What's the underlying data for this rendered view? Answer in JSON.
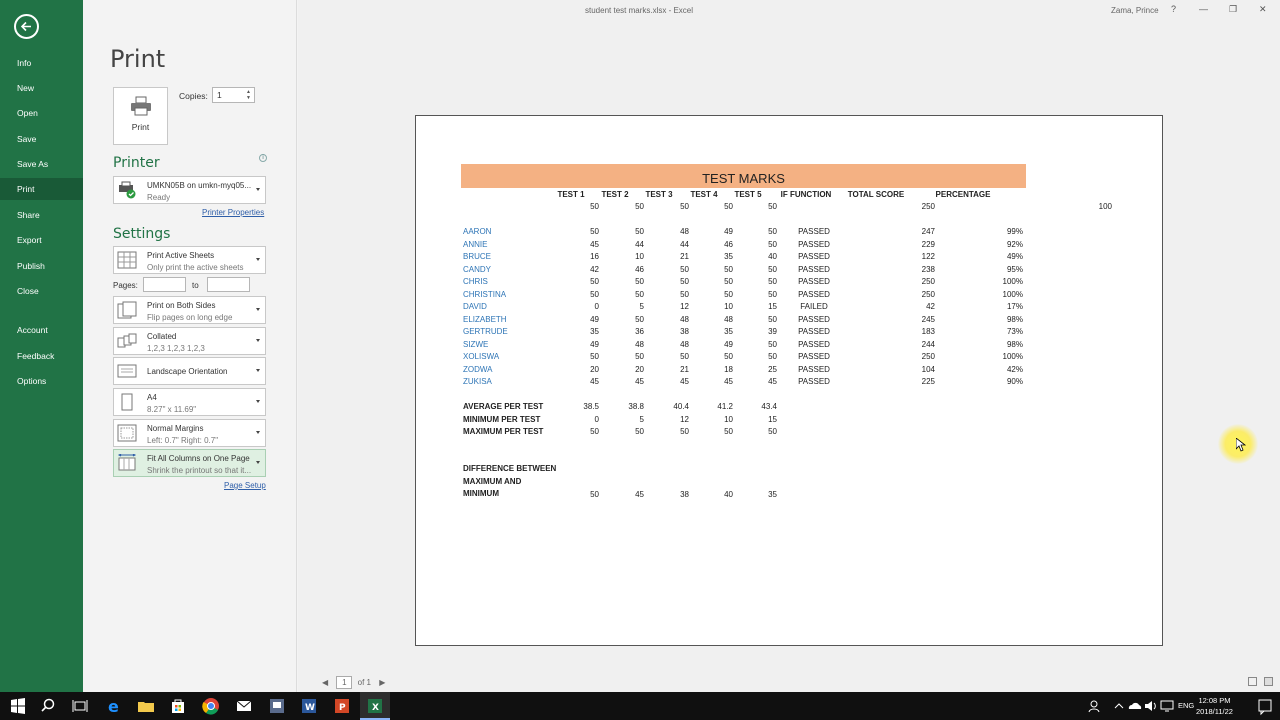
{
  "window": {
    "title": "student test marks.xlsx  -  Excel",
    "user": "Zama, Prince",
    "help": "?"
  },
  "nav": {
    "items": [
      "Info",
      "New",
      "Open",
      "Save",
      "Save As",
      "Print",
      "Share",
      "Export",
      "Publish",
      "Close",
      "Account",
      "Feedback",
      "Options"
    ],
    "active": "Print"
  },
  "print": {
    "heading": "Print",
    "button_label": "Print",
    "copies_label": "Copies:",
    "copies_value": "1"
  },
  "printer": {
    "heading": "Printer",
    "name": "UMKN05B on umkn-myq05...",
    "status": "Ready",
    "properties_link": "Printer Properties"
  },
  "settings": {
    "heading": "Settings",
    "sheets": {
      "title": "Print Active Sheets",
      "sub": "Only print the active sheets"
    },
    "pages_label": "Pages:",
    "to_label": "to",
    "sides": {
      "title": "Print on Both Sides",
      "sub": "Flip pages on long edge"
    },
    "collate": {
      "title": "Collated",
      "sub": "1,2,3    1,2,3    1,2,3"
    },
    "orientation": {
      "title": "Landscape Orientation"
    },
    "paper": {
      "title": "A4",
      "sub": "8.27\" x 11.69\""
    },
    "margins": {
      "title": "Normal Margins",
      "sub": "Left:  0.7\"    Right:  0.7\""
    },
    "scaling": {
      "title": "Fit All Columns on One Page",
      "sub": "Shrink the printout so that it..."
    },
    "page_setup_link": "Page Setup"
  },
  "sheet": {
    "banner": "TEST MARKS",
    "headers": [
      "TEST 1",
      "TEST 2",
      "TEST 3",
      "TEST 4",
      "TEST 5",
      "IF FUNCTION",
      "TOTAL SCORE",
      "PERCENTAGE"
    ],
    "max_row": [
      "50",
      "50",
      "50",
      "50",
      "50",
      "250",
      "100"
    ],
    "students": [
      {
        "name": "AARON",
        "scores": [
          "50",
          "50",
          "48",
          "49",
          "50"
        ],
        "result": "PASSED",
        "total": "247",
        "pct": "99%"
      },
      {
        "name": "ANNIE",
        "scores": [
          "45",
          "44",
          "44",
          "46",
          "50"
        ],
        "result": "PASSED",
        "total": "229",
        "pct": "92%"
      },
      {
        "name": "BRUCE",
        "scores": [
          "16",
          "10",
          "21",
          "35",
          "40"
        ],
        "result": "PASSED",
        "total": "122",
        "pct": "49%"
      },
      {
        "name": "CANDY",
        "scores": [
          "42",
          "46",
          "50",
          "50",
          "50"
        ],
        "result": "PASSED",
        "total": "238",
        "pct": "95%"
      },
      {
        "name": "CHRIS",
        "scores": [
          "50",
          "50",
          "50",
          "50",
          "50"
        ],
        "result": "PASSED",
        "total": "250",
        "pct": "100%"
      },
      {
        "name": "CHRISTINA",
        "scores": [
          "50",
          "50",
          "50",
          "50",
          "50"
        ],
        "result": "PASSED",
        "total": "250",
        "pct": "100%"
      },
      {
        "name": "DAVID",
        "scores": [
          "0",
          "5",
          "12",
          "10",
          "15"
        ],
        "result": "FAILED",
        "total": "42",
        "pct": "17%"
      },
      {
        "name": "ELIZABETH",
        "scores": [
          "49",
          "50",
          "48",
          "48",
          "50"
        ],
        "result": "PASSED",
        "total": "245",
        "pct": "98%"
      },
      {
        "name": "GERTRUDE",
        "scores": [
          "35",
          "36",
          "38",
          "35",
          "39"
        ],
        "result": "PASSED",
        "total": "183",
        "pct": "73%"
      },
      {
        "name": "SIZWE",
        "scores": [
          "49",
          "48",
          "48",
          "49",
          "50"
        ],
        "result": "PASSED",
        "total": "244",
        "pct": "98%"
      },
      {
        "name": "XOLISWA",
        "scores": [
          "50",
          "50",
          "50",
          "50",
          "50"
        ],
        "result": "PASSED",
        "total": "250",
        "pct": "100%"
      },
      {
        "name": "ZODWA",
        "scores": [
          "20",
          "20",
          "21",
          "18",
          "25"
        ],
        "result": "PASSED",
        "total": "104",
        "pct": "42%"
      },
      {
        "name": "ZUKISA",
        "scores": [
          "45",
          "45",
          "45",
          "45",
          "45"
        ],
        "result": "PASSED",
        "total": "225",
        "pct": "90%"
      }
    ],
    "stats": [
      {
        "label": "AVERAGE PER TEST",
        "values": [
          "38.5",
          "38.8",
          "40.4",
          "41.2",
          "43.4"
        ]
      },
      {
        "label": "MINIMUM PER TEST",
        "values": [
          "0",
          "5",
          "12",
          "10",
          "15"
        ]
      },
      {
        "label": "MAXIMUM PER TEST",
        "values": [
          "50",
          "50",
          "50",
          "50",
          "50"
        ]
      }
    ],
    "difference": {
      "label_lines": [
        "DIFFERENCE BETWEEN",
        "MAXIMUM AND",
        "MINIMUM"
      ],
      "values": [
        "50",
        "45",
        "38",
        "40",
        "35"
      ]
    }
  },
  "pager": {
    "current": "1",
    "of": "of 1"
  },
  "taskbar": {
    "lang": "ENG",
    "time": "12:08 PM",
    "date": "2018/11/22"
  },
  "colors": {
    "excel_green": "#217346",
    "banner": "#f4b183",
    "name_blue": "#2e75b6"
  }
}
